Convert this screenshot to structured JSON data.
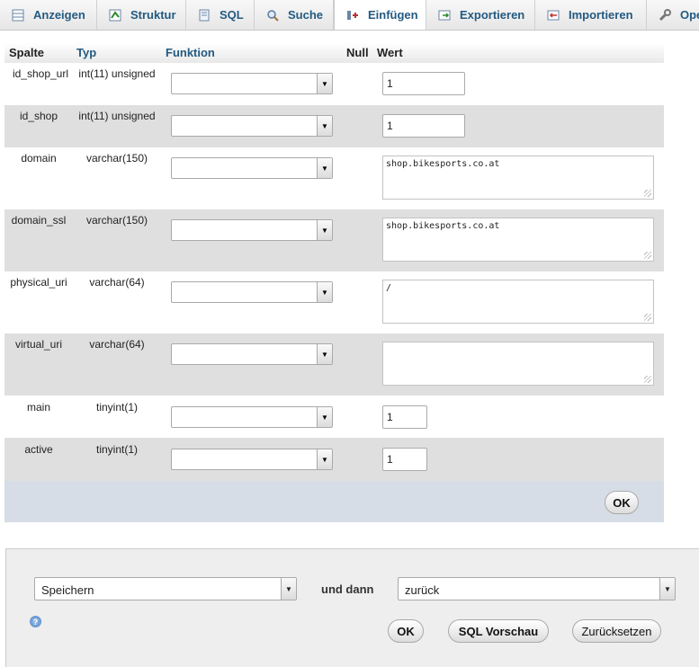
{
  "tabs": [
    {
      "label": "Anzeigen",
      "icon": "table-browse-icon"
    },
    {
      "label": "Struktur",
      "icon": "structure-icon"
    },
    {
      "label": "SQL",
      "icon": "sql-icon"
    },
    {
      "label": "Suche",
      "icon": "search-icon"
    },
    {
      "label": "Einfügen",
      "icon": "insert-icon"
    },
    {
      "label": "Exportieren",
      "icon": "export-icon"
    },
    {
      "label": "Importieren",
      "icon": "import-icon"
    },
    {
      "label": "Ope",
      "icon": "wrench-icon"
    }
  ],
  "active_tab": "Einfügen",
  "columns": {
    "spalte": "Spalte",
    "typ": "Typ",
    "funktion": "Funktion",
    "null": "Null",
    "wert": "Wert"
  },
  "rows": [
    {
      "name": "id_shop_url",
      "type": "int(11) unsigned",
      "function": "",
      "value": "1"
    },
    {
      "name": "id_shop",
      "type": "int(11) unsigned",
      "function": "",
      "value": "1"
    },
    {
      "name": "domain",
      "type": "varchar(150)",
      "function": "",
      "value": "shop.bikesports.co.at"
    },
    {
      "name": "domain_ssl",
      "type": "varchar(150)",
      "function": "",
      "value": "shop.bikesports.co.at"
    },
    {
      "name": "physical_uri",
      "type": "varchar(64)",
      "function": "",
      "value": "/"
    },
    {
      "name": "virtual_uri",
      "type": "varchar(64)",
      "function": "",
      "value": ""
    },
    {
      "name": "main",
      "type": "tinyint(1)",
      "function": "",
      "value": "1"
    },
    {
      "name": "active",
      "type": "tinyint(1)",
      "function": "",
      "value": "1"
    }
  ],
  "ok_label": "OK",
  "footer": {
    "action_select": "Speichern",
    "and_then": "und dann",
    "after_select": "zurück",
    "ok": "OK",
    "sql_preview": "SQL Vorschau",
    "reset": "Zurücksetzen",
    "help_icon": "help-icon"
  },
  "colors": {
    "link": "#235a81",
    "row_alt": "#dfdfdf",
    "ok_row": "#d6dde6",
    "footer_bg": "#eeeeee"
  }
}
